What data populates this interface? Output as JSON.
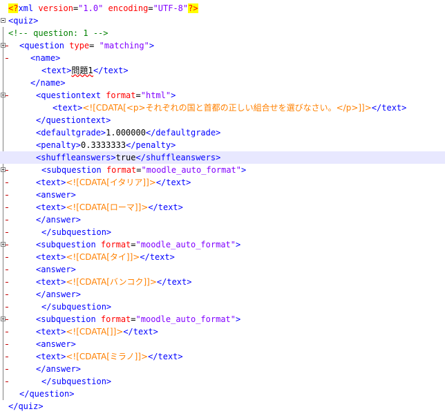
{
  "editor": {
    "lines": [
      {
        "parts": [
          [
            "pi",
            "<?"
          ],
          [
            "tag",
            "xml "
          ],
          [
            "attr",
            "version"
          ],
          [
            "txt",
            "="
          ],
          [
            "val",
            "\"1.0\" "
          ],
          [
            "attr",
            "encoding"
          ],
          [
            "txt",
            "="
          ],
          [
            "val",
            "\"UTF-8\""
          ],
          [
            "pi",
            "?>"
          ]
        ]
      },
      {
        "parts": [
          [
            "tag",
            "<quiz>"
          ]
        ]
      },
      {
        "parts": [
          [
            "comment",
            "<!-- question: 1 -->"
          ]
        ]
      },
      {
        "parts": [
          [
            "tag",
            "<question "
          ],
          [
            "attr",
            "type"
          ],
          [
            "txt",
            "= "
          ],
          [
            "val",
            "\"matching\""
          ],
          [
            "tag",
            ">"
          ]
        ]
      },
      {
        "parts": [
          [
            "tag",
            "<name>"
          ]
        ]
      },
      {
        "parts": [
          [
            "tag",
            "<text>"
          ],
          [
            "jp",
            "問題1"
          ],
          [
            "tag",
            "</text>"
          ]
        ]
      },
      {
        "parts": [
          [
            "tag",
            "</name>"
          ]
        ]
      },
      {
        "parts": [
          [
            "tag",
            "<questiontext "
          ],
          [
            "attr",
            "format"
          ],
          [
            "txt",
            "="
          ],
          [
            "val",
            "\"html\""
          ],
          [
            "tag",
            ">"
          ]
        ]
      },
      {
        "parts": [
          [
            "tag",
            "<text>"
          ],
          [
            "cdata",
            "<![CDATA[<p>それぞれの国と首都の正しい組合せを選びなさい。</p>]]>"
          ],
          [
            "tag",
            "</text>"
          ]
        ]
      },
      {
        "parts": [
          [
            "tag",
            "</questiontext>"
          ]
        ]
      },
      {
        "parts": [
          [
            "tag",
            "<defaultgrade>"
          ],
          [
            "txt",
            "1.000000"
          ],
          [
            "tag",
            "</defaultgrade>"
          ]
        ]
      },
      {
        "parts": [
          [
            "tag",
            "<penalty>"
          ],
          [
            "txt",
            "0.3333333"
          ],
          [
            "tag",
            "</penalty>"
          ]
        ]
      },
      {
        "parts": [
          [
            "tag",
            "<shuffleanswers>"
          ],
          [
            "txt",
            "true"
          ],
          [
            "tag",
            "</shuffleanswers>"
          ]
        ]
      },
      {
        "parts": [
          [
            "tag",
            "<subquestion "
          ],
          [
            "attr",
            "format"
          ],
          [
            "txt",
            "="
          ],
          [
            "val",
            "\"moodle_auto_format\""
          ],
          [
            "tag",
            ">"
          ]
        ]
      },
      {
        "parts": [
          [
            "tag",
            "<text>"
          ],
          [
            "cdata",
            "<![CDATA[イタリア]]>"
          ],
          [
            "tag",
            "</text>"
          ]
        ]
      },
      {
        "parts": [
          [
            "tag",
            "<answer>"
          ]
        ]
      },
      {
        "parts": [
          [
            "tag",
            "<text>"
          ],
          [
            "cdata",
            "<![CDATA[ローマ]]>"
          ],
          [
            "tag",
            "</text>"
          ]
        ]
      },
      {
        "parts": [
          [
            "tag",
            "</answer>"
          ]
        ]
      },
      {
        "parts": [
          [
            "tag",
            "</subquestion>"
          ]
        ]
      },
      {
        "parts": [
          [
            "tag",
            "<subquestion "
          ],
          [
            "attr",
            "format"
          ],
          [
            "txt",
            "="
          ],
          [
            "val",
            "\"moodle_auto_format\""
          ],
          [
            "tag",
            ">"
          ]
        ]
      },
      {
        "parts": [
          [
            "tag",
            "<text>"
          ],
          [
            "cdata",
            "<![CDATA[タイ]]>"
          ],
          [
            "tag",
            "</text>"
          ]
        ]
      },
      {
        "parts": [
          [
            "tag",
            "<answer>"
          ]
        ]
      },
      {
        "parts": [
          [
            "tag",
            "<text>"
          ],
          [
            "cdata",
            "<![CDATA[バンコク]]>"
          ],
          [
            "tag",
            "</text>"
          ]
        ]
      },
      {
        "parts": [
          [
            "tag",
            "</answer>"
          ]
        ]
      },
      {
        "parts": [
          [
            "tag",
            "</subquestion>"
          ]
        ]
      },
      {
        "parts": [
          [
            "tag",
            "<subquestion "
          ],
          [
            "attr",
            "format"
          ],
          [
            "txt",
            "="
          ],
          [
            "val",
            "\"moodle_auto_format\""
          ],
          [
            "tag",
            ">"
          ]
        ]
      },
      {
        "parts": [
          [
            "tag",
            "<text>"
          ],
          [
            "cdata",
            "<![CDATA[]]>"
          ],
          [
            "tag",
            "</text>"
          ]
        ]
      },
      {
        "parts": [
          [
            "tag",
            "<answer>"
          ]
        ]
      },
      {
        "parts": [
          [
            "tag",
            "<text>"
          ],
          [
            "cdata",
            "<![CDATA[ミラノ]]>"
          ],
          [
            "tag",
            "</text>"
          ]
        ]
      },
      {
        "parts": [
          [
            "tag",
            "</answer>"
          ]
        ]
      },
      {
        "parts": [
          [
            "tag",
            "</subquestion>"
          ]
        ]
      },
      {
        "parts": [
          [
            "tag",
            "</question>"
          ]
        ]
      },
      {
        "parts": [
          [
            "tag",
            "</quiz>"
          ]
        ]
      }
    ],
    "highlighted_line": 12,
    "colors": {
      "tag": "#0000ff",
      "attr": "#ff0000",
      "value": "#8000ff",
      "cdata": "#ff8000",
      "comment": "#008000",
      "pi_bg": "#ffff00",
      "current_line_bg": "#e8e8ff"
    }
  }
}
